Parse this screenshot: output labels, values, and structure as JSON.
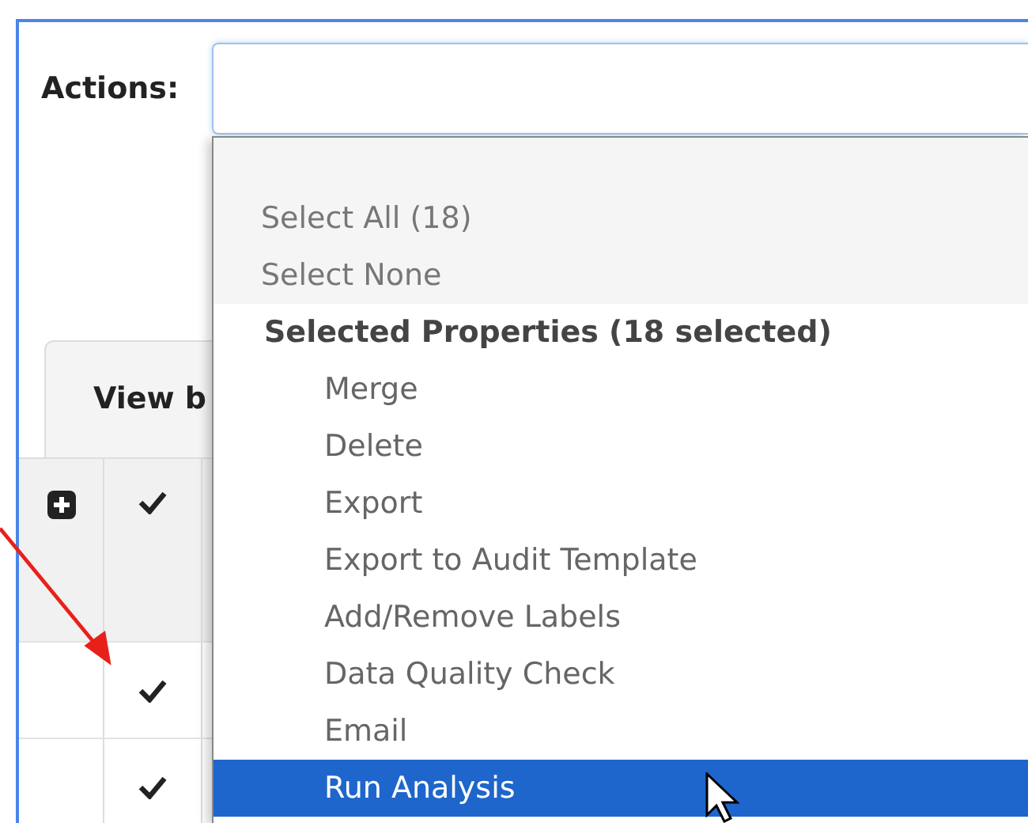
{
  "actions": {
    "label": "Actions:"
  },
  "tabs": [
    {
      "label": "View b",
      "selected": true
    }
  ],
  "table": {
    "rows": [
      {
        "kind": "header",
        "checked": true
      },
      {
        "kind": "row",
        "checked": true
      },
      {
        "kind": "row",
        "checked": true
      }
    ]
  },
  "menu": {
    "items": [
      {
        "kind": "option",
        "label": "Select All (18)",
        "selected": false
      },
      {
        "kind": "option",
        "label": "Select None",
        "selected": false
      },
      {
        "kind": "header",
        "label": "Selected Properties (18 selected)",
        "selected": false
      },
      {
        "kind": "action",
        "label": "Merge",
        "selected": false
      },
      {
        "kind": "action",
        "label": "Delete",
        "selected": false
      },
      {
        "kind": "action",
        "label": "Export",
        "selected": false
      },
      {
        "kind": "action",
        "label": "Export to Audit Template",
        "selected": false
      },
      {
        "kind": "action",
        "label": "Add/Remove Labels",
        "selected": false
      },
      {
        "kind": "action",
        "label": "Data Quality Check",
        "selected": false
      },
      {
        "kind": "action",
        "label": "Email",
        "selected": false
      },
      {
        "kind": "action",
        "label": "Run Analysis",
        "selected": true
      }
    ]
  }
}
